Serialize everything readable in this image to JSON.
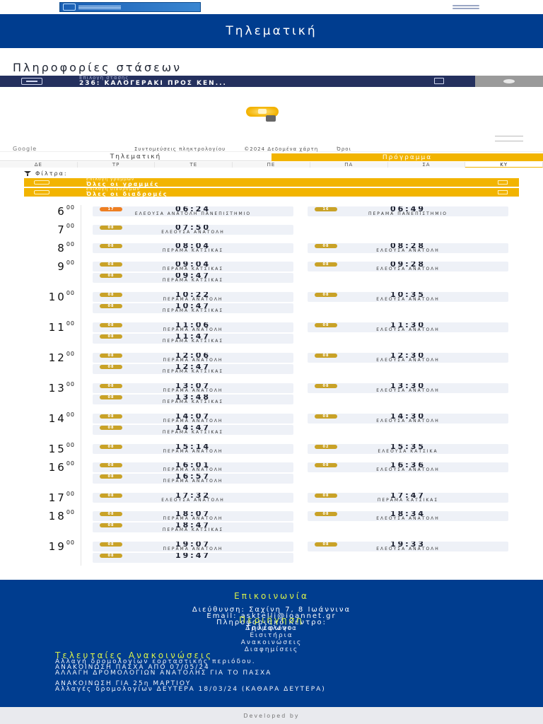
{
  "header": {
    "title": "Τηλεματική"
  },
  "page": {
    "heading": "Πληροφορίες στάσεων"
  },
  "stop": {
    "label": "Επιλογή στάσης",
    "value": "236: ΚΑΛΟΓΕΡΑΚΙ ΠΡΟΣ ΚΕΝ..."
  },
  "map": {
    "google": "Google",
    "shortcuts": "Συντομεύσεις πληκτρολογίου",
    "data": "©2024 Δεδομένα χάρτη",
    "terms": "Όροι"
  },
  "tabs": {
    "telematics": "Τηλεματική",
    "schedule": "Πρόγραμμα"
  },
  "days": [
    "ΔΕ",
    "ΤΡ",
    "ΤΕ",
    "ΠΕ",
    "ΠΑ",
    "ΣΑ",
    "ΚΥ"
  ],
  "active_day": "ΚΥ",
  "filters": {
    "title": "Φίλτρα:",
    "routes_label": "Επιλογή γραμμών",
    "routes_value": "Όλες οι γραμμές",
    "dirs_label": "Επιλογή διαδρομών",
    "dirs_value": "Όλες οι διαδρομές"
  },
  "schedule": [
    {
      "hour": "6",
      "min": "00",
      "left": [
        {
          "line": "17",
          "time": "06:24",
          "dest": "ΕΛΕΟΥΣΑ ΑΝΑΤΟΛΗ ΠΑΝΕΠΙΣΤΗΜΙΟ",
          "color": "orange"
        }
      ],
      "right": [
        {
          "line": "16",
          "time": "06:49",
          "dest": "ΠΕΡΑΜΑ ΠΑΝΕΠΙΣΤΗΜΙΟ"
        }
      ]
    },
    {
      "hour": "7",
      "min": "00",
      "left": [
        {
          "line": "08",
          "time": "07:50",
          "dest": "ΕΛΕΟΥΣΑ ΑΝΑΤΟΛΗ"
        }
      ],
      "right": []
    },
    {
      "hour": "8",
      "min": "00",
      "left": [
        {
          "line": "08",
          "time": "08:04",
          "dest": "ΠΕΡΑΜΑ ΚΑΤΣΙΚΑΣ"
        }
      ],
      "right": [
        {
          "line": "08",
          "time": "08:28",
          "dest": "ΕΛΕΟΥΣΑ ΑΝΑΤΟΛΗ"
        }
      ]
    },
    {
      "hour": "9",
      "min": "00",
      "left": [
        {
          "line": "08",
          "time": "09:04",
          "dest": "ΠΕΡΑΜΑ ΚΑΤΣΙΚΑΣ"
        },
        {
          "line": "08",
          "time": "09:47",
          "dest": "ΠΕΡΑΜΑ ΚΑΤΣΙΚΑΣ"
        }
      ],
      "right": [
        {
          "line": "08",
          "time": "09:28",
          "dest": "ΕΛΕΟΥΣΑ ΑΝΑΤΟΛΗ"
        }
      ]
    },
    {
      "hour": "10",
      "min": "00",
      "left": [
        {
          "line": "08",
          "time": "10:22",
          "dest": "ΠΕΡΑΜΑ ΑΝΑΤΟΛΗ"
        },
        {
          "line": "08",
          "time": "10:47",
          "dest": "ΠΕΡΑΜΑ ΚΑΤΣΙΚΑΣ"
        }
      ],
      "right": [
        {
          "line": "08",
          "time": "10:35",
          "dest": "ΕΛΕΟΥΣΑ ΑΝΑΤΟΛΗ"
        }
      ]
    },
    {
      "hour": "11",
      "min": "00",
      "left": [
        {
          "line": "08",
          "time": "11:06",
          "dest": "ΠΕΡΑΜΑ ΑΝΑΤΟΛΗ"
        },
        {
          "line": "08",
          "time": "11:47",
          "dest": "ΠΕΡΑΜΑ ΚΑΤΣΙΚΑΣ"
        }
      ],
      "right": [
        {
          "line": "08",
          "time": "11:30",
          "dest": "ΕΛΕΟΥΣΑ ΑΝΑΤΟΛΗ"
        }
      ]
    },
    {
      "hour": "12",
      "min": "00",
      "left": [
        {
          "line": "08",
          "time": "12:06",
          "dest": "ΠΕΡΑΜΑ ΑΝΑΤΟΛΗ"
        },
        {
          "line": "08",
          "time": "12:47",
          "dest": "ΠΕΡΑΜΑ ΚΑΤΣΙΚΑΣ"
        }
      ],
      "right": [
        {
          "line": "08",
          "time": "12:30",
          "dest": "ΕΛΕΟΥΣΑ ΑΝΑΤΟΛΗ"
        }
      ]
    },
    {
      "hour": "13",
      "min": "00",
      "left": [
        {
          "line": "08",
          "time": "13:07",
          "dest": "ΠΕΡΑΜΑ ΑΝΑΤΟΛΗ"
        },
        {
          "line": "08",
          "time": "13:48",
          "dest": "ΠΕΡΑΜΑ ΚΑΤΣΙΚΑΣ"
        }
      ],
      "right": [
        {
          "line": "08",
          "time": "13:30",
          "dest": "ΕΛΕΟΥΣΑ ΑΝΑΤΟΛΗ"
        }
      ]
    },
    {
      "hour": "14",
      "min": "00",
      "left": [
        {
          "line": "08",
          "time": "14:07",
          "dest": "ΠΕΡΑΜΑ ΑΝΑΤΟΛΗ"
        },
        {
          "line": "08",
          "time": "14:47",
          "dest": "ΠΕΡΑΜΑ ΚΑΤΣΙΚΑΣ"
        }
      ],
      "right": [
        {
          "line": "08",
          "time": "14:30",
          "dest": "ΕΛΕΟΥΣΑ ΑΝΑΤΟΛΗ"
        }
      ]
    },
    {
      "hour": "15",
      "min": "00",
      "left": [
        {
          "line": "08",
          "time": "15:14",
          "dest": "ΠΕΡΑΜΑ ΑΝΑΤΟΛΗ"
        }
      ],
      "right": [
        {
          "line": "02",
          "time": "15:35",
          "dest": "ΕΛΕΟΥΣΑ ΚΑΤΣΙΚΑ"
        }
      ]
    },
    {
      "hour": "16",
      "min": "00",
      "left": [
        {
          "line": "08",
          "time": "16:01",
          "dest": "ΠΕΡΑΜΑ ΑΝΑΤΟΛΗ"
        },
        {
          "line": "08",
          "time": "16:57",
          "dest": "ΠΕΡΑΜΑ ΑΝΑΤΟΛΗ"
        }
      ],
      "right": [
        {
          "line": "08",
          "time": "16:36",
          "dest": "ΕΛΕΟΥΣΑ ΑΝΑΤΟΛΗ"
        }
      ]
    },
    {
      "hour": "17",
      "min": "00",
      "left": [
        {
          "line": "08",
          "time": "17:32",
          "dest": "ΕΛΕΟΥΣΑ ΑΝΑΤΟΛΗ"
        }
      ],
      "right": [
        {
          "line": "08",
          "time": "17:47",
          "dest": "ΠΕΡΑΜΑ ΚΑΤΣΙΚΑΣ"
        }
      ]
    },
    {
      "hour": "18",
      "min": "00",
      "left": [
        {
          "line": "08",
          "time": "18:07",
          "dest": "ΠΕΡΑΜΑ ΑΝΑΤΟΛΗ"
        },
        {
          "line": "08",
          "time": "18:47",
          "dest": "ΠΕΡΑΜΑ ΚΑΤΣΙΚΑΣ"
        }
      ],
      "right": [
        {
          "line": "08",
          "time": "18:34",
          "dest": "ΕΛΕΟΥΣΑ ΑΝΑΤΟΛΗ"
        }
      ]
    },
    {
      "hour": "19",
      "min": "00",
      "left": [
        {
          "line": "08",
          "time": "19:07",
          "dest": "ΠΕΡΑΜΑ ΑΝΑΤΟΛΗ"
        },
        {
          "line": "08",
          "time": "19:47",
          "dest": ""
        }
      ],
      "right": [
        {
          "line": "08",
          "time": "19:33",
          "dest": "ΕΛΕΟΥΣΑ ΑΝΑΤΟΛΗ"
        }
      ]
    }
  ],
  "footer": {
    "contact_title": "Επικοινωνία",
    "address": "Διεύθυνση: Σαχίνη 7, 8 Ιωάννινα",
    "email": "Email: asktelli@ioannet.gr",
    "center": "Πληροφοριακό Κέντρο:",
    "phone": "Τηλέφωνο:",
    "nav_title": "Περιήγηση",
    "nav": [
      "Δρομολόγια",
      "Εισιτήρια",
      "Ανακοινώσεις",
      "Διαφημίσεις"
    ],
    "news_title": "Τελευταίες Ανακοινώσεις",
    "news": [
      "Αλλαγή δρομολογίων εορταστικής περιόδου.",
      "ΑΝΑΚΟΙΝΩΣΗ ΠΑΣΧΑ ΑΠΟ 07/05/24",
      "ΑΛΛΑΓΗ ΔΡΟΜΟΛΟΓΙΩΝ ΑΝΑΤΟΛΗΣ ΓΙΑ ΤΟ ΠΑΣΧΑ",
      "ΑΝΑΚΟΙΝΩΣΗ ΓΙΑ 25η ΜΑΡΤΙΟΥ",
      "Αλλαγές δρομολογίων ΔΕΥΤΕΡΑ 18/03/24 (ΚΑΘΑΡΑ ΔΕΥΤΕΡΑ)"
    ],
    "developed_by": "Developed by"
  },
  "colors": {
    "brand_blue": "#003d8f",
    "accent_yellow": "#f2b400",
    "badge_gold": "#c9a227",
    "badge_orange": "#ee7f22",
    "footer_highlight": "#d8f04a"
  }
}
